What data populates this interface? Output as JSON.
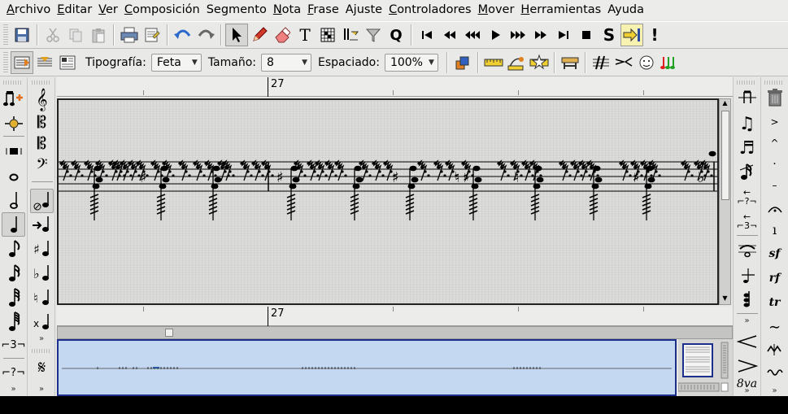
{
  "menubar": {
    "items": [
      {
        "key": "archivo",
        "mn": "A",
        "rest": "rchivo"
      },
      {
        "key": "editar",
        "mn": "E",
        "rest": "ditar"
      },
      {
        "key": "ver",
        "mn": "V",
        "rest": "er"
      },
      {
        "key": "composicion",
        "mn": "C",
        "rest": "omposición"
      },
      {
        "key": "segmento",
        "mn": "",
        "rest": "Segmento"
      },
      {
        "key": "nota",
        "mn": "N",
        "rest": "ota"
      },
      {
        "key": "frase",
        "mn": "F",
        "rest": "rase"
      },
      {
        "key": "ajuste",
        "mn": "",
        "rest": "Ajuste"
      },
      {
        "key": "controladores",
        "mn": "C",
        "rest": "ontroladores"
      },
      {
        "key": "mover",
        "mn": "M",
        "rest": "over"
      },
      {
        "key": "herramientas",
        "mn": "H",
        "rest": "erramientas"
      },
      {
        "key": "ayuda",
        "mn": "",
        "rest": "Ayuda"
      }
    ]
  },
  "toolbar1": {
    "text_tool": "T",
    "quantize_tool": "Q",
    "transport_stop": "■",
    "solo": "S",
    "panic": "!"
  },
  "toolbar2": {
    "font_label": "Tipografía:",
    "font_value": "Feta",
    "size_label": "Tamaño:",
    "size_value": "8",
    "spacing_label": "Espaciado:",
    "spacing_value": "100%"
  },
  "ruler": {
    "bar_number": "27"
  },
  "ruler_bottom": {
    "bar_number": "27"
  },
  "palette_left1": [
    "𝅘𝅥𝅮",
    "+",
    "𝄀",
    "○",
    "𝅗𝅥",
    "♩",
    "♪",
    "𝅘𝅥𝅯",
    "𝅘𝅥𝅰",
    "𝅘𝅥𝅱",
    "⌐3¬",
    "⌐?¬"
  ],
  "palette_left2": [
    "𝄞",
    "𝄡",
    "𝄡",
    "𝄢",
    "⊘",
    "→",
    "♯",
    "♭",
    "♮",
    "𝄌",
    "𝄋"
  ],
  "palette_right1": [
    "𝄂",
    "♫",
    "♬",
    "𝅘𝅥𝅯",
    "⌐3¬",
    "𝆐",
    "𝆑",
    "𝆒"
  ],
  "palette_right2": [
    "🗑",
    ">",
    "^",
    "·",
    "–",
    "⌒",
    "𝆏",
    "sf",
    "rf",
    "tr",
    "∼",
    "8va"
  ],
  "score": {
    "accidentals": [
      "♯",
      "♯",
      "♯",
      "♮",
      "♯",
      "♯",
      "♭"
    ]
  },
  "colors": {
    "panner_bg": "#c4d8f2",
    "panner_border": "#1c2f8a",
    "score_bg": "#d8d8d6"
  }
}
